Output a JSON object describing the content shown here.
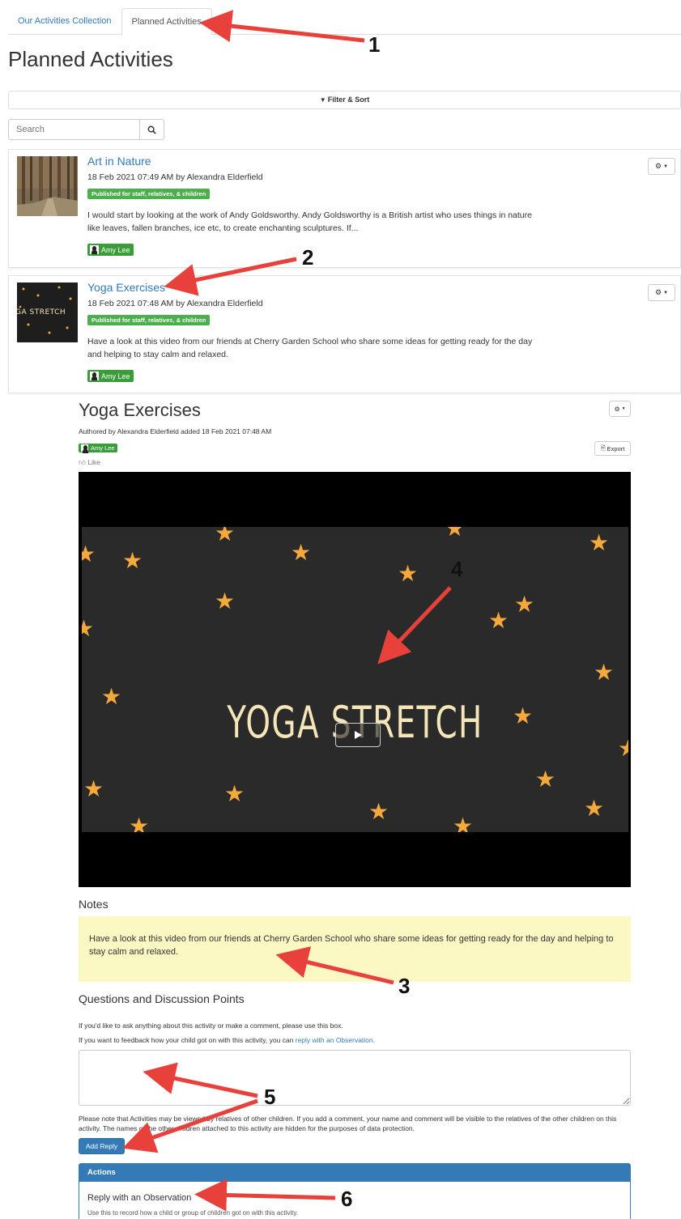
{
  "tabs": [
    {
      "label": "Our Activities Collection",
      "active": false
    },
    {
      "label": "Planned Activities",
      "active": true
    }
  ],
  "page_title": "Planned Activities",
  "filter": {
    "label": "Filter & Sort",
    "icon": "filter-icon"
  },
  "search": {
    "placeholder": "Search",
    "icon": "search-icon"
  },
  "activities": [
    {
      "title": "Art in Nature",
      "meta": "18 Feb 2021 07:49 AM by Alexandra Elderfield",
      "badge": "Published for staff, relatives, & children",
      "description": "I would start by looking at the work of Andy Goldsworthy. Andy Goldsworthy is a British artist who uses things in nature like leaves, fallen branches, ice etc, to create enchanting sculptures. If...",
      "child": "Amy Lee"
    },
    {
      "title": "Yoga Exercises",
      "meta": "18 Feb 2021 07:48 AM by Alexandra Elderfield",
      "badge": "Published for staff, relatives, & children",
      "description": "Have a look at this video from our friends at Cherry Garden School who share some ideas for getting ready for the day and helping to stay calm and relaxed.",
      "child": "Amy Lee",
      "thumb_text": "GA STRETCH"
    }
  ],
  "detail": {
    "title": "Yoga Exercises",
    "meta": "Authored by Alexandra Elderfield added 18 Feb 2021 07:48 AM",
    "child": "Amy Lee",
    "export_label": "Export",
    "like_label": "Like",
    "video_text": "YOGA STRETCH",
    "notes_heading": "Notes",
    "notes_text": "Have a look at this video from our friends at Cherry Garden School who share some ideas for getting ready for the day and helping to stay calm and relaxed.",
    "questions_heading": "Questions and Discussion Points",
    "question_line1": "If you'd like to ask anything about this activity or make a comment, please use this box.",
    "question_line2_prefix": "If you want to feedback how your child got on with this activity, you can ",
    "question_line2_link": "reply with an Observation",
    "question_line2_suffix": ".",
    "privacy_note": "Please note that Activities may be viewed by relatives of other children. If you add a comment, your name and comment will be visible to the relatives of the other children on this activity. The names of the other children attached to this activity are hidden for the purposes of data protection.",
    "add_reply_label": "Add Reply",
    "actions_heading": "Actions",
    "action_title": "Reply with an Observation",
    "action_sub": "Use this to record how a child or group of children got on with this activity."
  },
  "annotations": [
    "1",
    "2",
    "3",
    "4",
    "5",
    "6"
  ],
  "colors": {
    "link": "#337ab7",
    "badge_green": "#4cae4c",
    "notes_bg": "#fcf8c3",
    "primary": "#337ab7",
    "arrow": "#e8403a",
    "star": "#f6a93b"
  }
}
